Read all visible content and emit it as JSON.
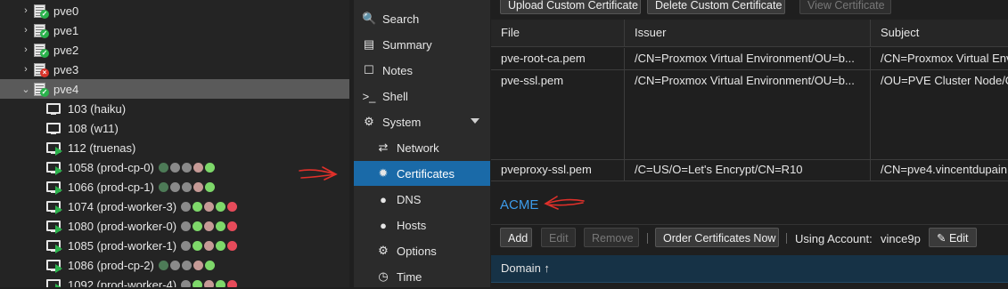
{
  "tree": {
    "nodes": [
      {
        "kind": "node",
        "label": "pve0",
        "status": "ok",
        "expander": "›"
      },
      {
        "kind": "node",
        "label": "pve1",
        "status": "ok",
        "expander": "›"
      },
      {
        "kind": "node",
        "label": "pve2",
        "status": "ok",
        "expander": "›"
      },
      {
        "kind": "node",
        "label": "pve3",
        "status": "error",
        "expander": "›"
      },
      {
        "kind": "node",
        "label": "pve4",
        "status": "ok",
        "expander": "⌄",
        "selected": true
      },
      {
        "kind": "vm",
        "label": "103 (haiku)",
        "running": false,
        "dots": []
      },
      {
        "kind": "vm",
        "label": "108 (w11)",
        "running": false,
        "dots": []
      },
      {
        "kind": "vm",
        "label": "112 (truenas)",
        "running": true,
        "dots": []
      },
      {
        "kind": "vm",
        "label": "1058 (prod-cp-0)",
        "running": true,
        "dots": [
          "#4d7b57",
          "#8a8a8a",
          "#8a8a8a",
          "#c69a96",
          "#7ed86a"
        ]
      },
      {
        "kind": "vm",
        "label": "1066 (prod-cp-1)",
        "running": true,
        "dots": [
          "#4d7b57",
          "#8a8a8a",
          "#8a8a8a",
          "#c69a96",
          "#7ed86a"
        ]
      },
      {
        "kind": "vm",
        "label": "1074 (prod-worker-3)",
        "running": true,
        "dots": [
          "#8a8a8a",
          "#7ed86a",
          "#c69a96",
          "#7ed86a",
          "#e64b5a"
        ]
      },
      {
        "kind": "vm",
        "label": "1080 (prod-worker-0)",
        "running": true,
        "dots": [
          "#8a8a8a",
          "#7ed86a",
          "#c69a96",
          "#7ed86a",
          "#e64b5a"
        ]
      },
      {
        "kind": "vm",
        "label": "1085 (prod-worker-1)",
        "running": true,
        "dots": [
          "#8a8a8a",
          "#7ed86a",
          "#c69a96",
          "#7ed86a",
          "#e64b5a"
        ]
      },
      {
        "kind": "vm",
        "label": "1086 (prod-cp-2)",
        "running": true,
        "dots": [
          "#4d7b57",
          "#8a8a8a",
          "#8a8a8a",
          "#c69a96",
          "#7ed86a"
        ]
      },
      {
        "kind": "vm",
        "label": "1092 (prod-worker-4)",
        "running": true,
        "dots": [
          "#8a8a8a",
          "#7ed86a",
          "#c69a96",
          "#7ed86a",
          "#e64b5a"
        ]
      }
    ]
  },
  "nav": {
    "items": [
      {
        "label": "Search",
        "icon": "🔍",
        "sub": false
      },
      {
        "label": "Summary",
        "icon": "▤",
        "sub": false
      },
      {
        "label": "Notes",
        "icon": "☐",
        "sub": false
      },
      {
        "label": "Shell",
        "icon": ">_",
        "sub": false
      },
      {
        "label": "System",
        "icon": "⚙",
        "sub": false,
        "caret": true
      },
      {
        "label": "Network",
        "icon": "⇄",
        "sub": true
      },
      {
        "label": "Certificates",
        "icon": "✹",
        "sub": true,
        "active": true
      },
      {
        "label": "DNS",
        "icon": "●",
        "sub": true
      },
      {
        "label": "Hosts",
        "icon": "●",
        "sub": true
      },
      {
        "label": "Options",
        "icon": "⚙",
        "sub": true
      },
      {
        "label": "Time",
        "icon": "◷",
        "sub": true
      }
    ]
  },
  "toolbar": {
    "upload": "Upload Custom Certificate",
    "delete": "Delete Custom Certificate",
    "view": "View Certificate"
  },
  "certs": {
    "headers": {
      "file": "File",
      "issuer": "Issuer",
      "subject": "Subject"
    },
    "rows": [
      {
        "file": "pve-root-ca.pem",
        "issuer": "/CN=Proxmox Virtual Environment/OU=b...",
        "subject": "/CN=Proxmox Virtual Env"
      },
      {
        "file": "pve-ssl.pem",
        "issuer": "/CN=Proxmox Virtual Environment/OU=b...",
        "subject": "/OU=PVE Cluster Node/O"
      },
      {
        "file": "pveproxy-ssl.pem",
        "issuer": "/C=US/O=Let's Encrypt/CN=R10",
        "subject": "/CN=pve4.vincentdupain."
      }
    ]
  },
  "acme": {
    "title": "ACME",
    "add": "Add",
    "edit_disabled": "Edit",
    "remove": "Remove",
    "order": "Order Certificates Now",
    "using_account_label": "Using Account:",
    "account": "vince9p",
    "edit": "Edit",
    "domain_header": "Domain ↑"
  },
  "colors": {
    "accent": "#1a6aa8",
    "link": "#3d9be9",
    "annotation": "#e0302a"
  }
}
